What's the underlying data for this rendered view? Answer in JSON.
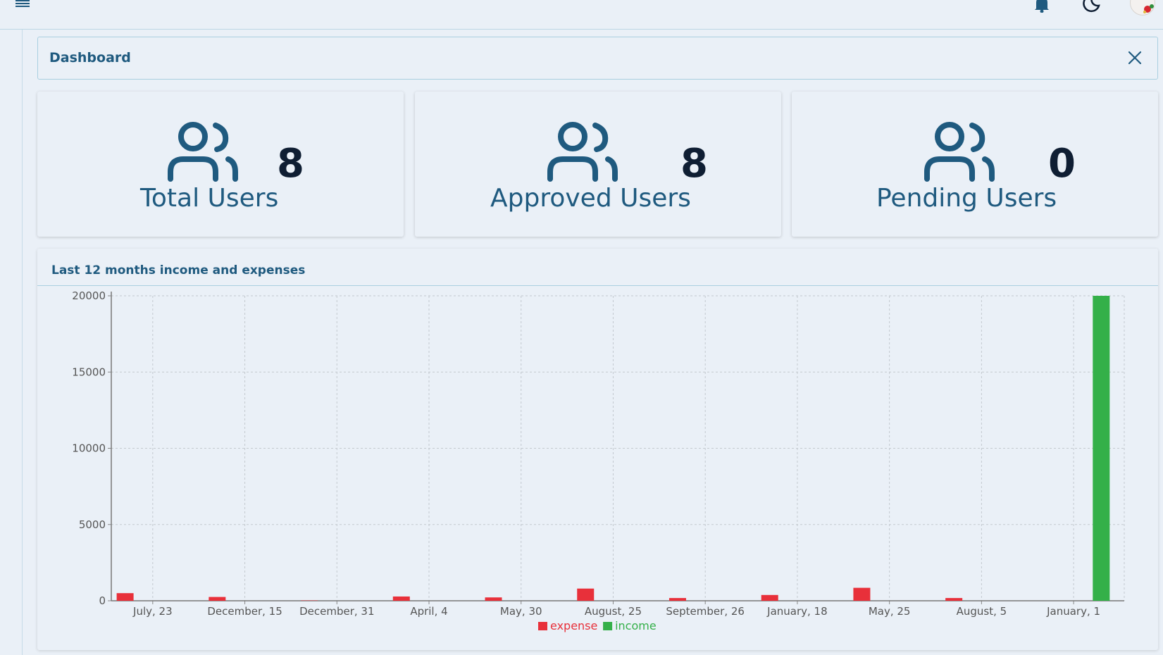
{
  "header": {
    "menu_icon": "hamburger-menu-icon",
    "notification_icon": "bell-icon",
    "theme_icon": "moon-icon",
    "avatar": "user-avatar"
  },
  "dashboard": {
    "title": "Dashboard",
    "close_icon": "close-icon"
  },
  "stats": [
    {
      "label": "Total Users",
      "count": "8",
      "icon": "users-icon"
    },
    {
      "label": "Approved Users",
      "count": "8",
      "icon": "users-icon"
    },
    {
      "label": "Pending Users",
      "count": "0",
      "icon": "users-icon"
    }
  ],
  "chart_section": {
    "title": "Last 12 months income and expenses"
  },
  "colors": {
    "expense": "#e8303a",
    "income": "#34b049",
    "primary": "#1f5a7f"
  },
  "chart_data": {
    "type": "bar",
    "categories": [
      "July, 23",
      "December, 15",
      "December, 31",
      "April, 4",
      "May, 30",
      "August, 25",
      "September, 26",
      "January, 18",
      "May, 25",
      "August, 5",
      "January, 1"
    ],
    "series": [
      {
        "name": "expense",
        "values": [
          500,
          250,
          20,
          280,
          220,
          800,
          180,
          380,
          850,
          180,
          0
        ]
      },
      {
        "name": "income",
        "values": [
          0,
          0,
          0,
          0,
          0,
          0,
          0,
          0,
          0,
          0,
          20000
        ]
      }
    ],
    "ylim": [
      0,
      20000
    ],
    "yticks": [
      0,
      5000,
      10000,
      15000,
      20000
    ],
    "grid": true,
    "legend": "bottom-center"
  }
}
